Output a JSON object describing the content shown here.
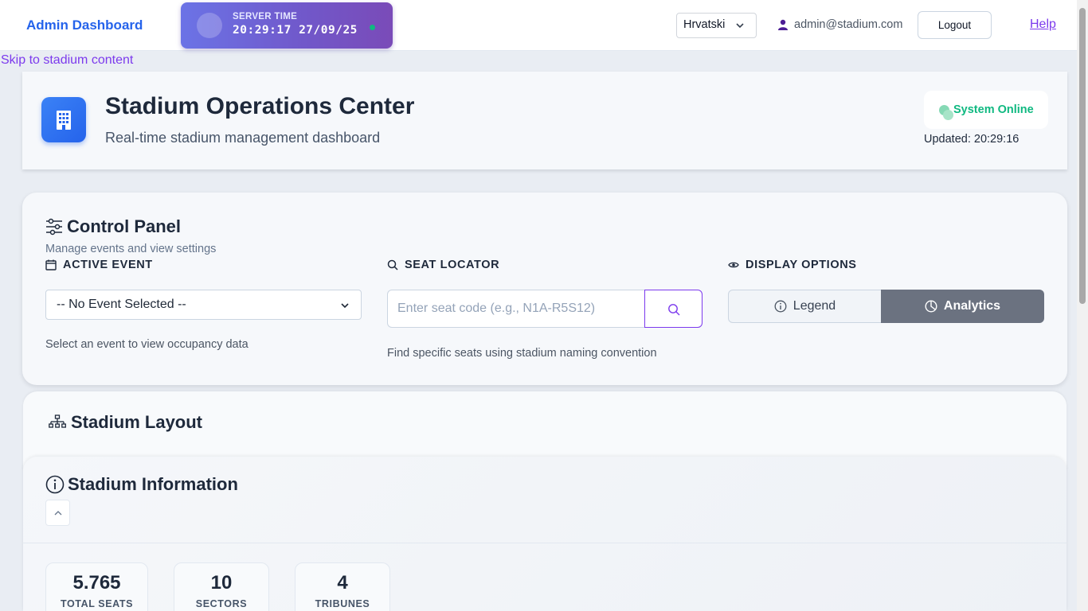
{
  "nav": {
    "brand": "Admin Dashboard",
    "server_time_label": "SERVER TIME",
    "server_time_value": "20:29:17 27/09/25",
    "language": "Hrvatski",
    "user_email": "admin@stadium.com",
    "logout_label": "Logout",
    "help_label": "Help"
  },
  "skip_link": "Skip to stadium content",
  "header": {
    "title": "Stadium Operations Center",
    "subtitle": "Real-time stadium management dashboard",
    "status": "System Online",
    "updated": "Updated: 20:29:16"
  },
  "control_panel": {
    "title": "Control Panel",
    "description": "Manage events and view settings",
    "active_event": {
      "label": "ACTIVE EVENT",
      "selected": "-- No Event Selected --",
      "helper": "Select an event to view occupancy data"
    },
    "seat_locator": {
      "label": "SEAT LOCATOR",
      "placeholder": "Enter seat code (e.g., N1A-R5S12)",
      "helper": "Find specific seats using stadium naming convention"
    },
    "display_options": {
      "label": "DISPLAY OPTIONS",
      "legend": "Legend",
      "analytics": "Analytics"
    }
  },
  "stadium_layout": {
    "title": "Stadium Layout"
  },
  "stadium_info": {
    "title": "Stadium Information",
    "stats": [
      {
        "value": "5.765",
        "label": "TOTAL SEATS"
      },
      {
        "value": "10",
        "label": "SECTORS"
      },
      {
        "value": "4",
        "label": "TRIBUNES"
      }
    ]
  },
  "colors": {
    "brand": "#2563eb",
    "accent": "#7c3aed",
    "online": "#10b981",
    "active_toggle": "#6b7280"
  },
  "icons": {
    "header": "building-icon",
    "control_panel": "sliders-icon",
    "active_event": "calendar-icon",
    "seat_locator": "search-icon",
    "display_options": "eye-icon",
    "legend": "info-icon",
    "analytics": "pie-chart-icon",
    "stadium_layout": "sitemap-icon",
    "stadium_info": "info-icon",
    "user": "user-icon"
  }
}
